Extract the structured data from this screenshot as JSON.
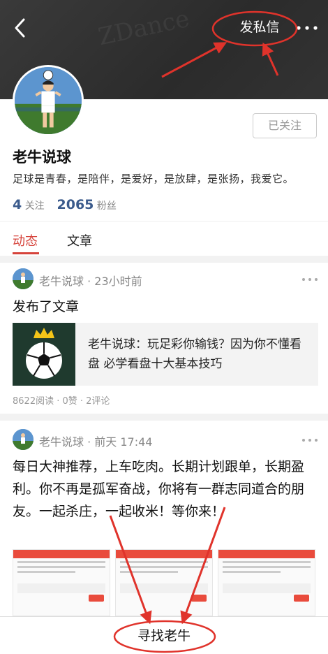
{
  "header": {
    "back_icon": "chevron-left-icon",
    "watermark_text": "ZDance",
    "send_message_label": "发私信",
    "more_icon": "more-dots-icon"
  },
  "profile": {
    "name": "老牛说球",
    "follow_button_label": "已关注",
    "bio": "足球是青春，是陪伴，是爱好，是放肆，是张扬，我爱它。",
    "following_count": "4",
    "following_label": "关注",
    "fans_count": "2065",
    "fans_label": "粉丝"
  },
  "tabs": [
    {
      "label": "动态",
      "active": true
    },
    {
      "label": "文章",
      "active": false
    }
  ],
  "posts": [
    {
      "author_meta": "老牛说球 · 23小时前",
      "text": "发布了文章",
      "article": {
        "title": "老牛说球：玩足彩你输钱？因为你不懂看盘 必学看盘十大基本技巧"
      },
      "stats": "8622阅读 · 0赞 · 2评论"
    },
    {
      "author_meta": "老牛说球 · 前天 17:44",
      "text": "每日大神推荐，上车吃肉。长期计划跟单，长期盈利。你不再是孤军奋战，你将有一群志同道合的朋友。一起杀庄，一起收米！等你来！"
    }
  ],
  "bottom_bar": {
    "find_label": "寻找老牛"
  },
  "colors": {
    "accent": "#d6433b",
    "count_blue": "#3b5b8c",
    "annotation_red": "#e0332b",
    "header_bg": "#2e2e2e"
  }
}
